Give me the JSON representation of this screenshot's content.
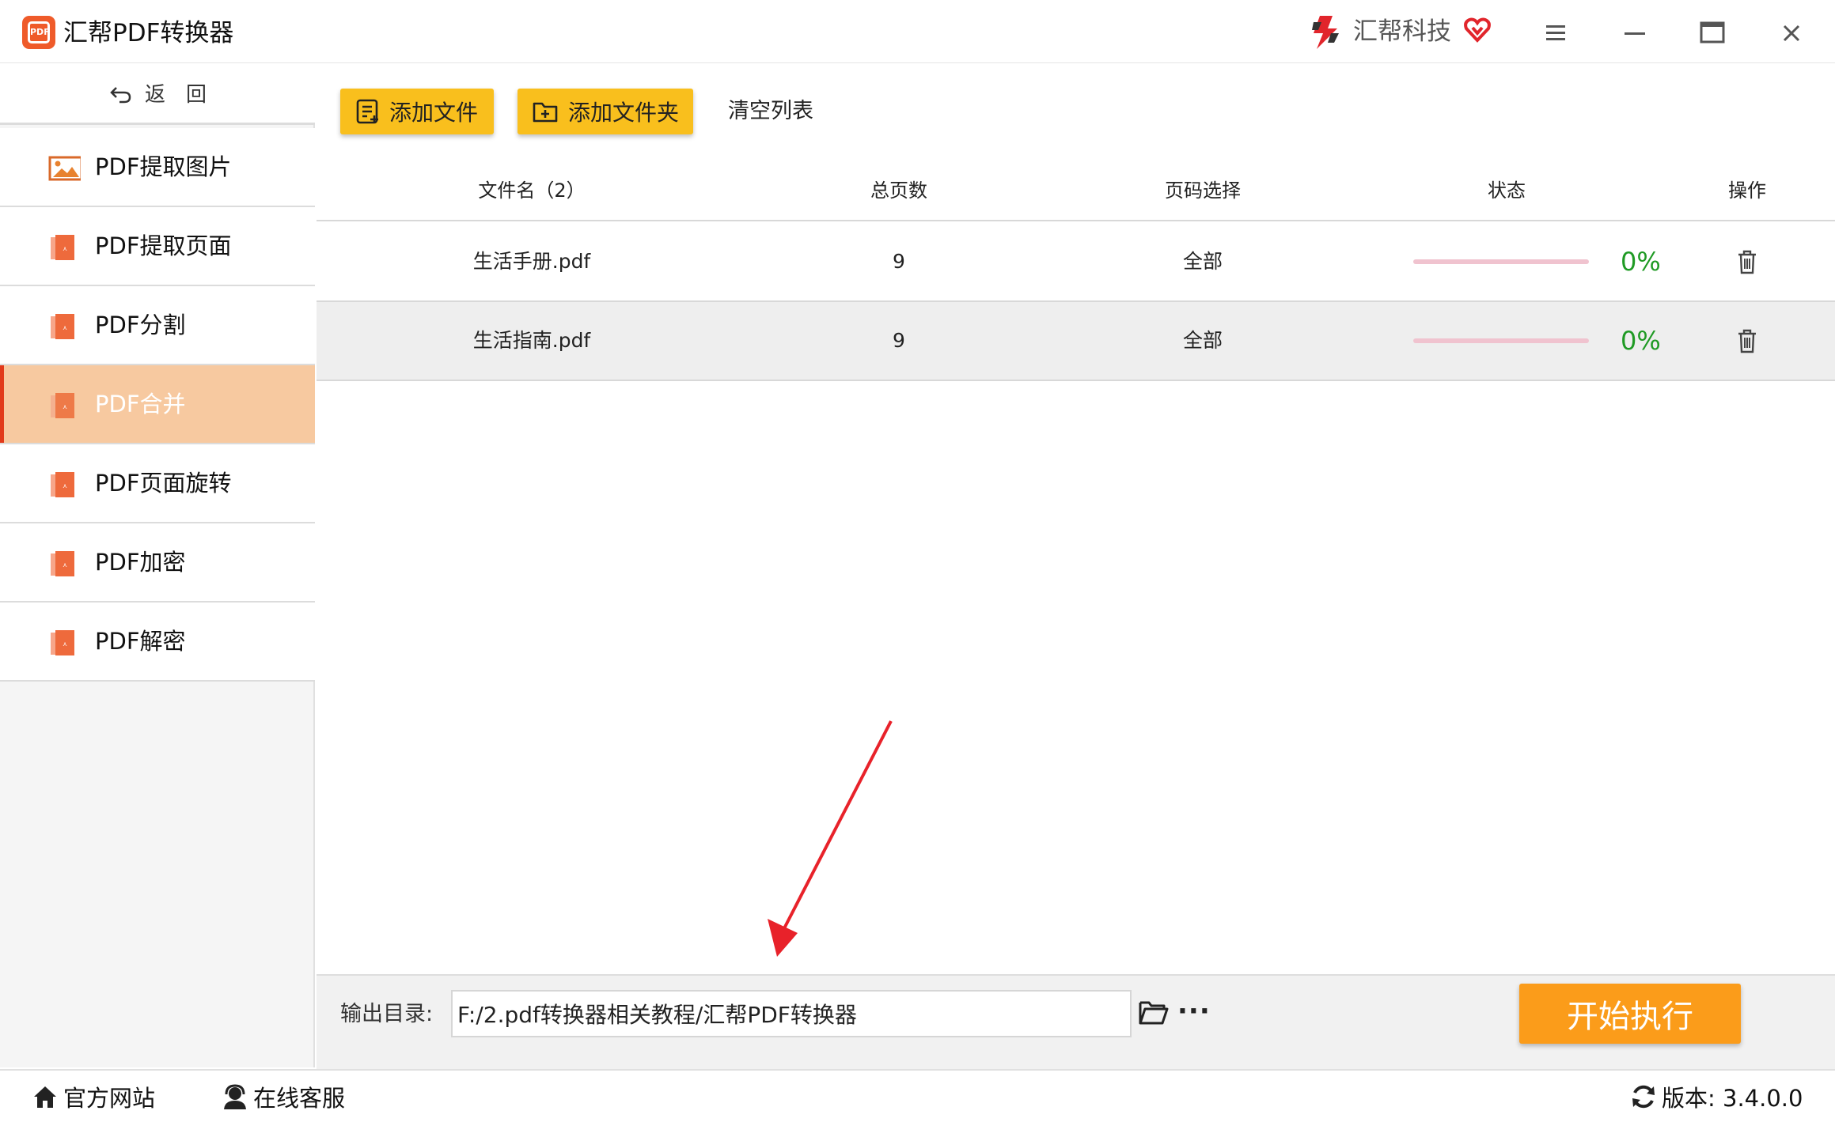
{
  "app": {
    "title": "汇帮PDF转换器",
    "logo_text": "PDF",
    "brand": "汇帮科技"
  },
  "window_controls": [
    "menu-icon",
    "minimize-icon",
    "maximize-icon",
    "close-icon"
  ],
  "sidebar": {
    "back_label": "返　回",
    "items": [
      {
        "label": "PDF提取图片",
        "icon": "image-icon",
        "active": false
      },
      {
        "label": "PDF提取页面",
        "icon": "pdf-file-icon",
        "active": false
      },
      {
        "label": "PDF分割",
        "icon": "pdf-file-icon",
        "active": false
      },
      {
        "label": "PDF合并",
        "icon": "pdf-file-icon",
        "active": true
      },
      {
        "label": "PDF页面旋转",
        "icon": "pdf-file-icon",
        "active": false
      },
      {
        "label": "PDF加密",
        "icon": "pdf-file-icon",
        "active": false
      },
      {
        "label": "PDF解密",
        "icon": "pdf-file-icon",
        "active": false
      }
    ]
  },
  "toolbar": {
    "add_file": "添加文件",
    "add_folder": "添加文件夹",
    "clear_list": "清空列表"
  },
  "table": {
    "headers": {
      "filename": "文件名（2）",
      "pages": "总页数",
      "page_select": "页码选择",
      "status": "状态",
      "action": "操作"
    },
    "rows": [
      {
        "filename": "生活手册.pdf",
        "pages": "9",
        "page_select": "全部",
        "progress": 0,
        "progress_text": "0%"
      },
      {
        "filename": "生活指南.pdf",
        "pages": "9",
        "page_select": "全部",
        "progress": 0,
        "progress_text": "0%"
      }
    ]
  },
  "output": {
    "label": "输出目录:",
    "path": "F:/2.pdf转换器相关教程/汇帮PDF转换器",
    "more": "···"
  },
  "start_button": "开始执行",
  "statusbar": {
    "website": "官方网站",
    "support": "在线客服",
    "version": "版本:  3.4.0.0"
  },
  "colors": {
    "accent_yellow": "#f9bf1d",
    "start_orange": "#fb9c1a",
    "active_item": "#f7c9a0",
    "active_marker": "#e23a1a",
    "progress_track": "#f0c3cf",
    "percent_green": "#1f9a24",
    "annotation_arrow": "#e8222a"
  }
}
